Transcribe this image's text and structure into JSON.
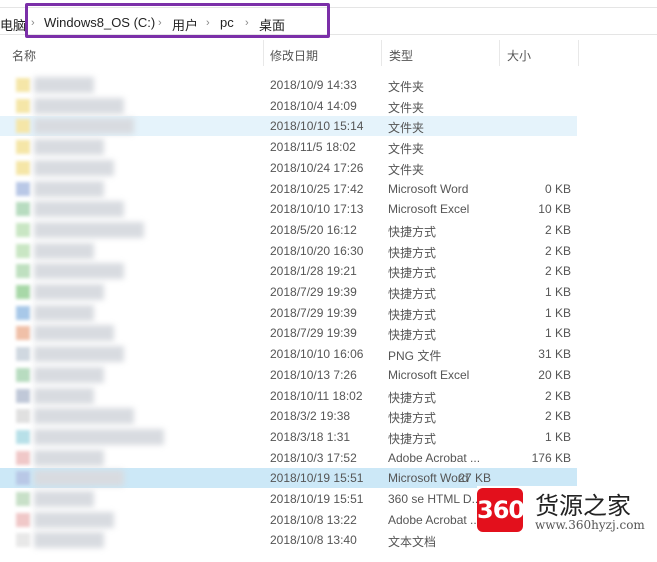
{
  "breadcrumb": {
    "items": [
      "电脑",
      "Windows8_OS (C:)",
      "用户",
      "pc",
      "桌面"
    ],
    "highlight_color": "#7b2fa8"
  },
  "columns": [
    "名称",
    "修改日期",
    "类型",
    "大小"
  ],
  "rows": [
    {
      "date": "2018/10/9 14:33",
      "type": "文件夹",
      "size": "",
      "icon": "#f5e6a8"
    },
    {
      "date": "2018/10/4 14:09",
      "type": "文件夹",
      "size": "",
      "icon": "#f5e6a8"
    },
    {
      "date": "2018/10/10 15:14",
      "type": "文件夹",
      "size": "",
      "icon": "#f5e6a8",
      "state": "hover"
    },
    {
      "date": "2018/11/5 18:02",
      "type": "文件夹",
      "size": "",
      "icon": "#f5e6a8"
    },
    {
      "date": "2018/10/24 17:26",
      "type": "文件夹",
      "size": "",
      "icon": "#f5e6a8"
    },
    {
      "date": "2018/10/25 17:42",
      "type": "Microsoft Word",
      "size": "0 KB",
      "icon": "#b9c8e6"
    },
    {
      "date": "2018/10/10 17:13",
      "type": "Microsoft Excel",
      "size": "10 KB",
      "icon": "#b8dcc0"
    },
    {
      "date": "2018/5/20 16:12",
      "type": "快捷方式",
      "size": "2 KB",
      "icon": "#c9e6c4"
    },
    {
      "date": "2018/10/20 16:30",
      "type": "快捷方式",
      "size": "2 KB",
      "icon": "#c9e6c4"
    },
    {
      "date": "2018/1/28 19:21",
      "type": "快捷方式",
      "size": "2 KB",
      "icon": "#bfe0c0"
    },
    {
      "date": "2018/7/29 19:39",
      "type": "快捷方式",
      "size": "1 KB",
      "icon": "#a8d8a8"
    },
    {
      "date": "2018/7/29 19:39",
      "type": "快捷方式",
      "size": "1 KB",
      "icon": "#a8c8e8"
    },
    {
      "date": "2018/7/29 19:39",
      "type": "快捷方式",
      "size": "1 KB",
      "icon": "#f0c0a8"
    },
    {
      "date": "2018/10/10 16:06",
      "type": "PNG 文件",
      "size": "31 KB",
      "icon": "#d0d8e0"
    },
    {
      "date": "2018/10/13 7:26",
      "type": "Microsoft Excel",
      "size": "20 KB",
      "icon": "#b8dcc0"
    },
    {
      "date": "2018/10/11 18:02",
      "type": "快捷方式",
      "size": "2 KB",
      "icon": "#c0c8d8"
    },
    {
      "date": "2018/3/2 19:38",
      "type": "快捷方式",
      "size": "2 KB",
      "icon": "#e0e0e0"
    },
    {
      "date": "2018/3/18 1:31",
      "type": "快捷方式",
      "size": "1 KB",
      "icon": "#b8e0e8"
    },
    {
      "date": "2018/10/3 17:52",
      "type": "Adobe Acrobat ...",
      "size": "176 KB",
      "icon": "#f0c8c8"
    },
    {
      "date": "2018/10/19 15:51",
      "type": "Microsoft Word",
      "size": "27 KB",
      "icon": "#b9c8e6",
      "state": "selected"
    },
    {
      "date": "2018/10/19 15:51",
      "type": "360 se HTML D...",
      "size": "",
      "icon": "#c8e0c8"
    },
    {
      "date": "2018/10/8 13:22",
      "type": "Adobe Acrobat ...",
      "size": "",
      "icon": "#f0c8c8"
    },
    {
      "date": "2018/10/8 13:40",
      "type": "文本文档",
      "size": "",
      "icon": "#e8e8e8"
    }
  ],
  "watermark": {
    "logo": "360",
    "title": "货源之家",
    "url": "www.360hyzj.com"
  }
}
